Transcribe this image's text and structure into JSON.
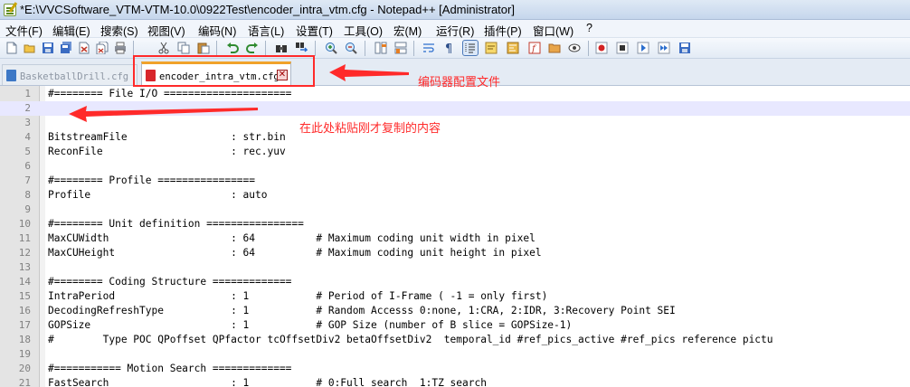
{
  "window": {
    "title": "*E:\\VVCSoftware_VTM-VTM-10.0\\0922Test\\encoder_intra_vtm.cfg - Notepad++ [Administrator]"
  },
  "menu": [
    {
      "label": "文件(F)"
    },
    {
      "label": "编辑(E)"
    },
    {
      "label": "搜索(S)"
    },
    {
      "label": "视图(V)"
    },
    {
      "label": "编码(N)"
    },
    {
      "label": "语言(L)"
    },
    {
      "label": "设置(T)"
    },
    {
      "label": "工具(O)"
    },
    {
      "label": "宏(M)"
    },
    {
      "label": "运行(R)"
    },
    {
      "label": "插件(P)"
    },
    {
      "label": "窗口(W)"
    },
    {
      "label": "?"
    }
  ],
  "toolbar": {
    "buttons": [
      {
        "icon": "new-file-icon"
      },
      {
        "icon": "open-file-icon"
      },
      {
        "icon": "save-icon"
      },
      {
        "icon": "save-all-icon"
      },
      {
        "icon": "close-icon"
      },
      {
        "icon": "close-all-icon"
      },
      {
        "icon": "print-icon"
      },
      {
        "icon": "cut-icon"
      },
      {
        "icon": "copy-icon"
      },
      {
        "icon": "paste-icon"
      },
      {
        "icon": "undo-icon"
      },
      {
        "icon": "redo-icon"
      },
      {
        "icon": "find-icon"
      },
      {
        "icon": "replace-icon"
      },
      {
        "icon": "zoom-in-icon"
      },
      {
        "icon": "zoom-out-icon"
      },
      {
        "icon": "sync-vertical-icon"
      },
      {
        "icon": "sync-horizontal-icon"
      },
      {
        "icon": "word-wrap-icon"
      },
      {
        "icon": "show-all-characters-icon"
      },
      {
        "icon": "indent-guide-icon"
      },
      {
        "icon": "user-language-icon"
      },
      {
        "icon": "document-map-icon"
      },
      {
        "icon": "function-list-icon"
      },
      {
        "icon": "folder-workspace-icon"
      },
      {
        "icon": "monitoring-icon"
      },
      {
        "icon": "record-macro-icon"
      },
      {
        "icon": "stop-recording-icon"
      },
      {
        "icon": "playback-macro-icon"
      },
      {
        "icon": "run-macro-multiple-icon"
      },
      {
        "icon": "save-macro-icon"
      }
    ]
  },
  "tabs": [
    {
      "label": "BasketballDrill.cfg",
      "active": false
    },
    {
      "label": "encoder_intra_vtm.cfg",
      "active": true
    }
  ],
  "editor": {
    "lines": [
      {
        "n": "1",
        "text": "#======== File I/O ====================="
      },
      {
        "n": "2",
        "text": ""
      },
      {
        "n": "3",
        "text": ""
      },
      {
        "n": "4",
        "text": "BitstreamFile                 : str.bin"
      },
      {
        "n": "5",
        "text": "ReconFile                     : rec.yuv"
      },
      {
        "n": "6",
        "text": ""
      },
      {
        "n": "7",
        "text": "#======== Profile ================"
      },
      {
        "n": "8",
        "text": "Profile                       : auto"
      },
      {
        "n": "9",
        "text": ""
      },
      {
        "n": "10",
        "text": "#======== Unit definition ================"
      },
      {
        "n": "11",
        "text": "MaxCUWidth                    : 64          # Maximum coding unit width in pixel"
      },
      {
        "n": "12",
        "text": "MaxCUHeight                   : 64          # Maximum coding unit height in pixel"
      },
      {
        "n": "13",
        "text": ""
      },
      {
        "n": "14",
        "text": "#======== Coding Structure ============="
      },
      {
        "n": "15",
        "text": "IntraPeriod                   : 1           # Period of I-Frame ( -1 = only first)"
      },
      {
        "n": "16",
        "text": "DecodingRefreshType           : 1           # Random Accesss 0:none, 1:CRA, 2:IDR, 3:Recovery Point SEI"
      },
      {
        "n": "17",
        "text": "GOPSize                       : 1           # GOP Size (number of B slice = GOPSize-1)"
      },
      {
        "n": "18",
        "text": "#        Type POC QPoffset QPfactor tcOffsetDiv2 betaOffsetDiv2  temporal_id #ref_pics_active #ref_pics reference pictu"
      },
      {
        "n": "19",
        "text": ""
      },
      {
        "n": "20",
        "text": "#=========== Motion Search ============="
      },
      {
        "n": "21",
        "text": "FastSearch                    : 1           # 0:Full search  1:TZ search"
      }
    ]
  },
  "annotations": {
    "config_file_label": "编码器配置文件",
    "paste_here_label": "在此处粘贴刚才复制的内容",
    "color": "#ff2a2a"
  }
}
